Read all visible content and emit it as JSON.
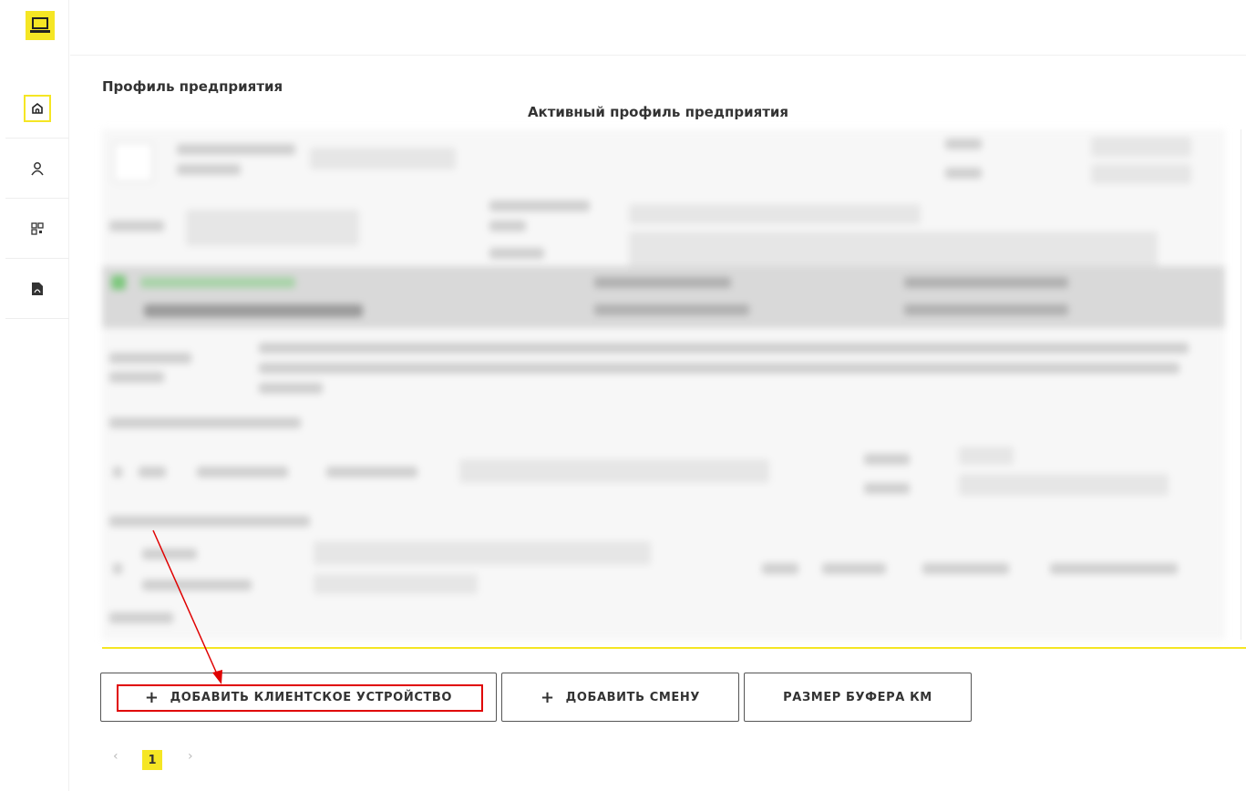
{
  "page": {
    "title": "Профиль предприятия",
    "subtitle": "Активный профиль предприятия"
  },
  "sidebar": {
    "logo_icon": "laptop-icon",
    "items": [
      {
        "icon": "home-icon",
        "active": true
      },
      {
        "icon": "user-icon",
        "active": false
      },
      {
        "icon": "scan-icon",
        "active": false
      },
      {
        "icon": "pdf-icon",
        "active": false
      }
    ]
  },
  "actions": {
    "add_client_device": "ДОБАВИТЬ КЛИЕНТСКОЕ УСТРОЙСТВО",
    "add_shift": "ДОБАВИТЬ СМЕНУ",
    "buffer_size": "РАЗМЕР БУФЕРА КМ",
    "plus_glyph": "+"
  },
  "pagination": {
    "prev": "‹",
    "current": "1",
    "next": "›"
  },
  "colors": {
    "accent": "#f5e624",
    "annotation": "#e00000"
  }
}
